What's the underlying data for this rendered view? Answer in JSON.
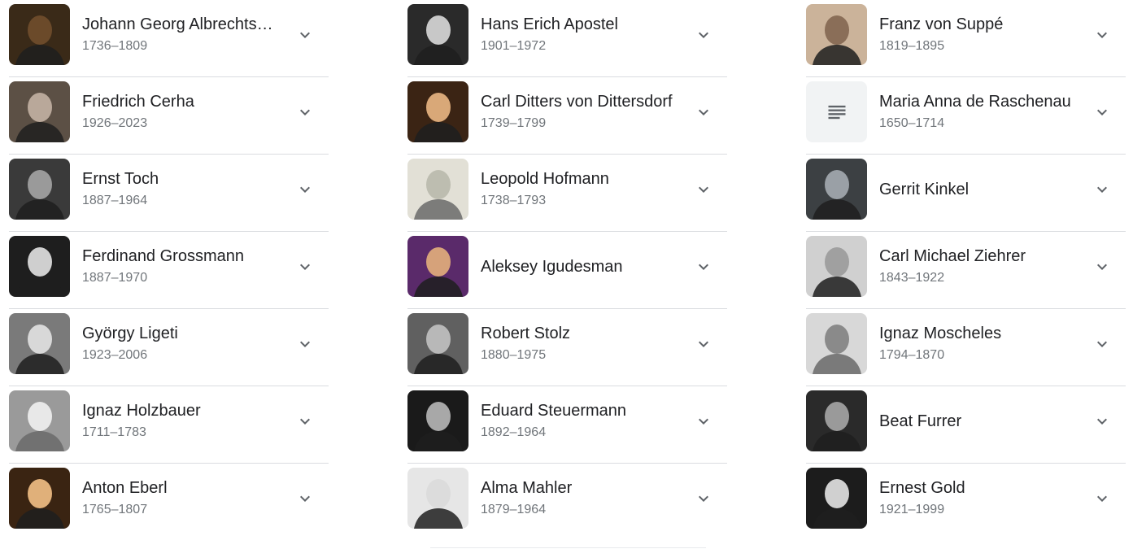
{
  "columns": [
    {
      "items": [
        {
          "name": "Johann Georg Albrechts…",
          "dates": "1736–1809",
          "photo": "portrait-painting",
          "tone": "#6b4a2a",
          "bg": "#3a2a18"
        },
        {
          "name": "Friedrich Cerha",
          "dates": "1926–2023",
          "photo": "portrait-photo",
          "tone": "#b9a89a",
          "bg": "#5c5045"
        },
        {
          "name": "Ernst Toch",
          "dates": "1887–1964",
          "photo": "portrait-photo-bw",
          "tone": "#9a9a9a",
          "bg": "#3a3a3a"
        },
        {
          "name": "Ferdinand Grossmann",
          "dates": "1887–1970",
          "photo": "portrait-photo-bw",
          "tone": "#cfcfcf",
          "bg": "#1e1e1e"
        },
        {
          "name": "György Ligeti",
          "dates": "1923–2006",
          "photo": "portrait-photo-bw",
          "tone": "#d8d8d8",
          "bg": "#7a7a7a"
        },
        {
          "name": "Ignaz Holzbauer",
          "dates": "1711–1783",
          "photo": "portrait-engraving",
          "tone": "#e8e8e8",
          "bg": "#9a9a9a"
        },
        {
          "name": "Anton Eberl",
          "dates": "1765–1807",
          "photo": "portrait-painting",
          "tone": "#e0b07a",
          "bg": "#3a2412"
        }
      ]
    },
    {
      "items": [
        {
          "name": "Hans Erich Apostel",
          "dates": "1901–1972",
          "photo": "portrait-photo-bw",
          "tone": "#c8c8c8",
          "bg": "#2a2a2a"
        },
        {
          "name": "Carl Ditters von Dittersdorf",
          "dates": "1739–1799",
          "photo": "portrait-painting",
          "tone": "#d9a878",
          "bg": "#3b2414"
        },
        {
          "name": "Leopold Hofmann",
          "dates": "1738–1793",
          "photo": "portrait-engraving",
          "tone": "#bdbdb0",
          "bg": "#e2e0d6"
        },
        {
          "name": "Aleksey Igudesman",
          "dates": "",
          "photo": "portrait-photo",
          "tone": "#d6a27a",
          "bg": "#5a2a6a"
        },
        {
          "name": "Robert Stolz",
          "dates": "1880–1975",
          "photo": "portrait-photo-bw",
          "tone": "#b8b8b8",
          "bg": "#606060"
        },
        {
          "name": "Eduard Steuermann",
          "dates": "1892–1964",
          "photo": "portrait-photo-bw",
          "tone": "#a8a8a8",
          "bg": "#1a1a1a"
        },
        {
          "name": "Alma Mahler",
          "dates": "1879–1964",
          "photo": "portrait-photo-bw",
          "tone": "#dcdcdc",
          "bg": "#e6e6e6"
        }
      ]
    },
    {
      "items": [
        {
          "name": "Franz von Suppé",
          "dates": "1819–1895",
          "photo": "portrait-photo-sepia",
          "tone": "#8a6e58",
          "bg": "#cbb39a"
        },
        {
          "name": "Maria Anna de Raschenau",
          "dates": "1650–1714",
          "photo": "document-placeholder-icon",
          "tone": "#5f6368",
          "bg": "#f1f3f4"
        },
        {
          "name": "Gerrit Kinkel",
          "dates": "",
          "photo": "portrait-photo",
          "tone": "#9aa0a6",
          "bg": "#3c4043"
        },
        {
          "name": "Carl Michael Ziehrer",
          "dates": "1843–1922",
          "photo": "portrait-photo-bw",
          "tone": "#a0a0a0",
          "bg": "#d0d0d0"
        },
        {
          "name": "Ignaz Moscheles",
          "dates": "1794–1870",
          "photo": "portrait-engraving",
          "tone": "#8a8a8a",
          "bg": "#d8d8d8"
        },
        {
          "name": "Beat Furrer",
          "dates": "",
          "photo": "portrait-photo-bw",
          "tone": "#9a9a9a",
          "bg": "#2a2a2a"
        },
        {
          "name": "Ernest Gold",
          "dates": "1921–1999",
          "photo": "portrait-photo-bw",
          "tone": "#d0d0d0",
          "bg": "#1c1c1c"
        }
      ]
    }
  ],
  "icons": {
    "expand": "chevron-down-icon"
  },
  "colors": {
    "name_text": "#202124",
    "dates_text": "#70757a",
    "divider": "#dadce0",
    "chevron": "#5f6368"
  }
}
